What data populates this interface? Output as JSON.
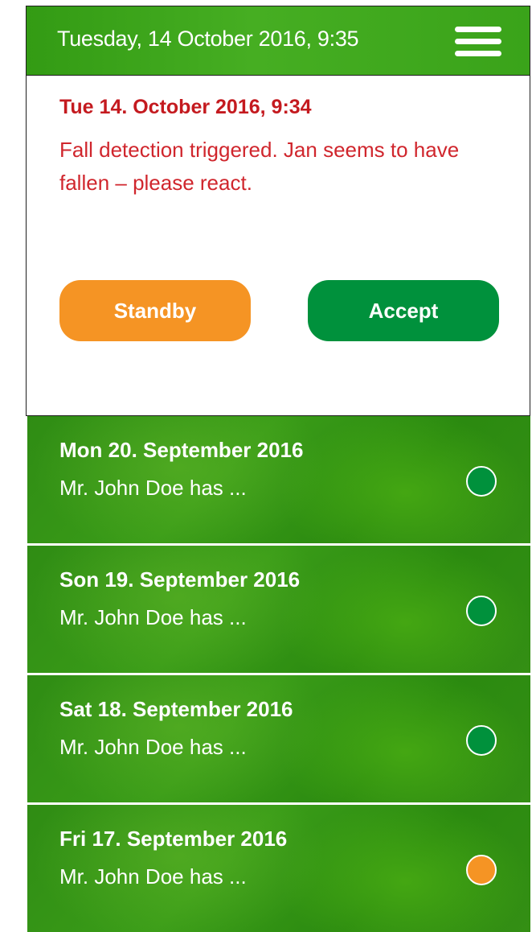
{
  "header": {
    "title": "Tuesday, 14 October 2016, 9:35",
    "menu_icon": "hamburger-menu-icon"
  },
  "alert": {
    "date": "Tue 14. October 2016, 9:34",
    "message": "Fall detection triggered. Jan seems to have fallen – please react.",
    "standby_label": "Standby",
    "accept_label": "Accept"
  },
  "colors": {
    "alert_text": "#d0262d",
    "standby": "#f59424",
    "accept": "#00913c",
    "header_green": "#46ae22",
    "status_green": "#00913c",
    "status_orange": "#f59424"
  },
  "items": [
    {
      "date": "Mon 20. September 2016",
      "text": "Mr. John Doe has ...",
      "status_color": "#00913c"
    },
    {
      "date": "Son 19. September 2016",
      "text": "Mr. John Doe has ...",
      "status_color": "#00913c"
    },
    {
      "date": "Sat 18. September 2016",
      "text": "Mr. John Doe has ...",
      "status_color": "#00913c"
    },
    {
      "date": "Fri 17. September 2016",
      "text": "Mr. John Doe has ...",
      "status_color": "#f59424"
    }
  ]
}
